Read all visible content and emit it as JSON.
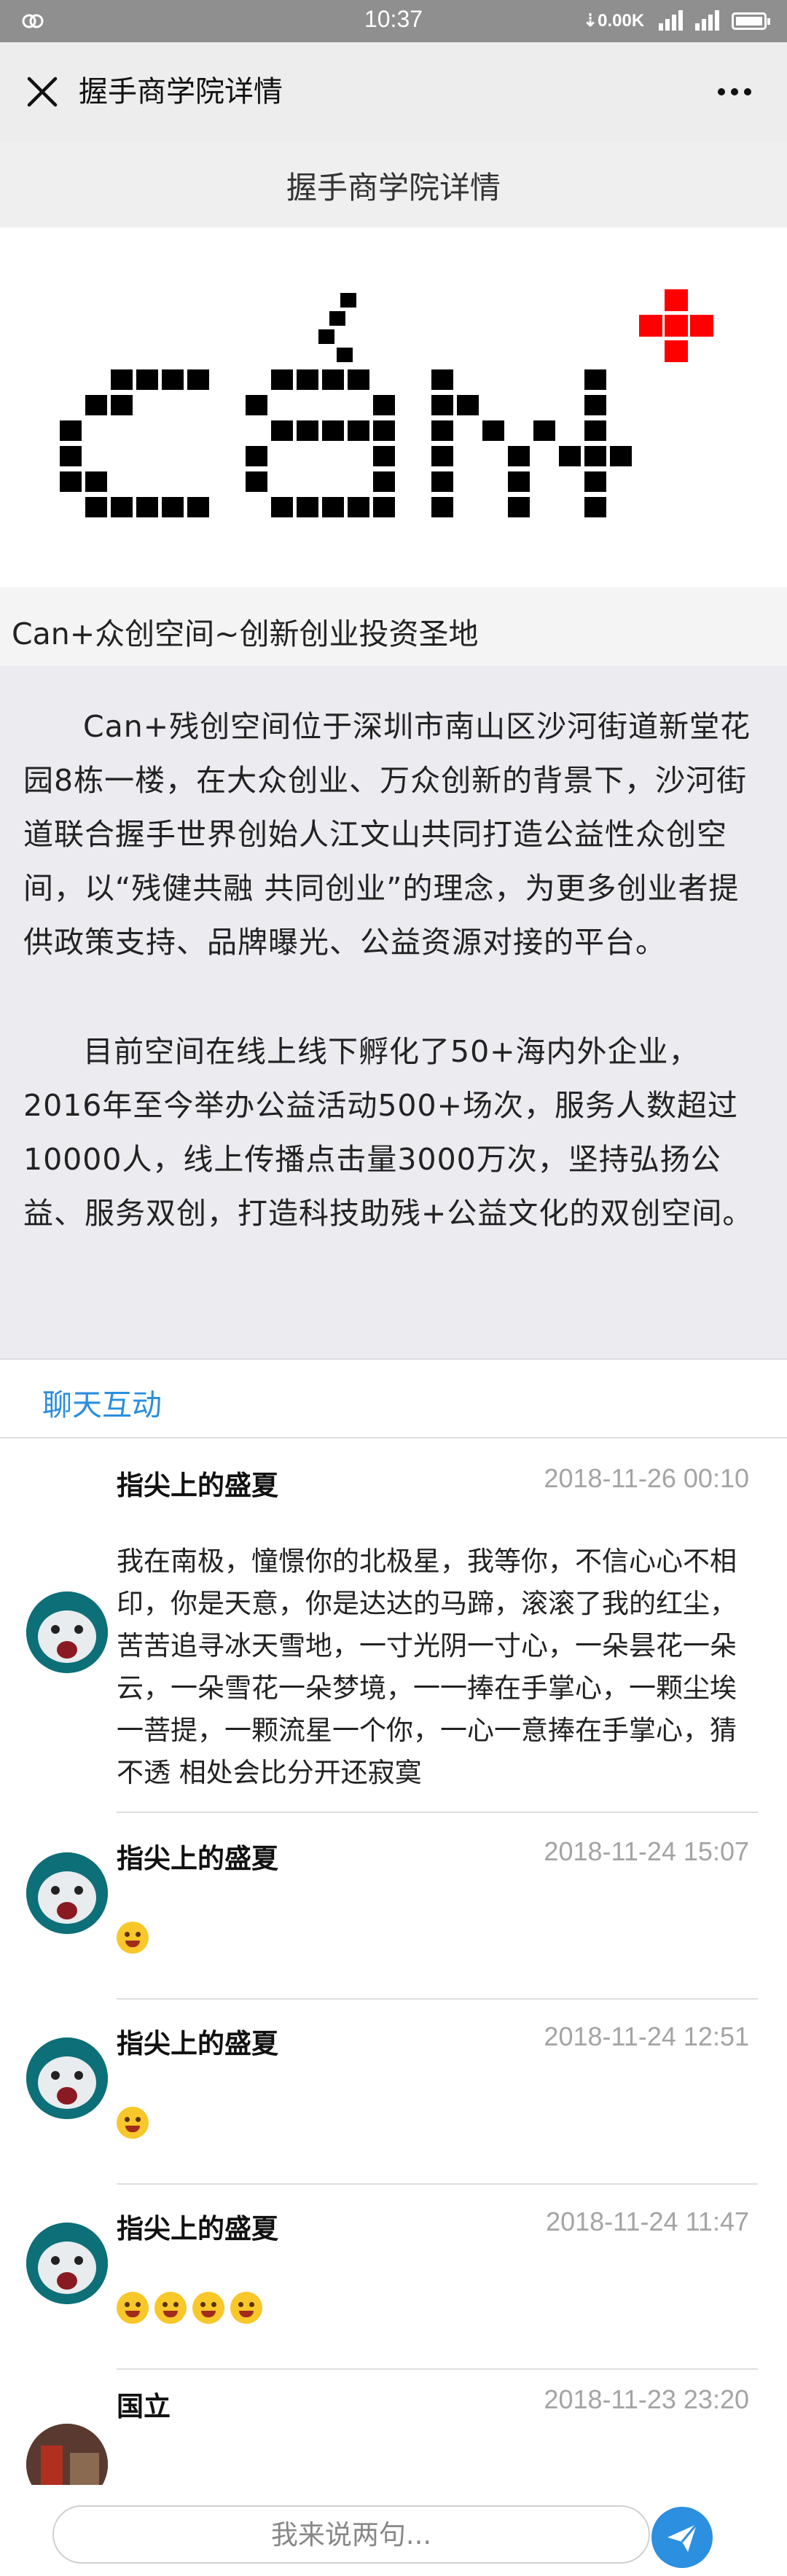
{
  "status_bar": {
    "time": "10:37",
    "net_speed": "⇣0.00K",
    "icons": [
      "circle-chain-icon",
      "signal-icon",
      "signal-icon",
      "battery-icon"
    ]
  },
  "title_bar": {
    "title": "握手商学院详情",
    "close_icon": "close-icon",
    "more_icon": "more-icon"
  },
  "page": {
    "header": "握手商学院详情",
    "banner_caption": "Can+众创空间~创新创业投资圣地",
    "banner_logo_text": "Can+",
    "description": [
      "Can+残创空间位于深圳市南山区沙河街道新堂花园8栋一楼，在大众创业、万众创新的背景下，沙河街道联合握手世界创始人江文山共同打造公益性众创空间，以“残健共融 共同创业”的理念，为更多创业者提供政策支持、品牌曝光、公益资源对接的平台。",
      "目前空间在线上线下孵化了50+海内外企业，2016年至今举办公益活动500+场次，服务人数超过10000人，线上传播点击量3000万次，坚持弘扬公益、服务双创，打造科技助残+公益文化的双创空间。"
    ]
  },
  "tabs": {
    "chat": "聊天互动"
  },
  "comments": [
    {
      "name": "指尖上的盛夏",
      "time": "2018-11-26 00:10",
      "text": "我在南极，憧憬你的北极星，我等你，不信心心不相印，你是天意，你是达达的马蹄，滚滚了我的红尘，苦苦追寻冰天雪地，一寸光阴一寸心，一朵昙花一朵云，一朵雪花一朵梦境，一一捧在手掌心，一颗尘埃一菩提，一颗流星一个你，一心一意捧在手掌心，猜不透 相处会比分开还寂寞"
    },
    {
      "name": "指尖上的盛夏",
      "time": "2018-11-24 15:07",
      "emojis": [
        "wink-tongue-emoji"
      ]
    },
    {
      "name": "指尖上的盛夏",
      "time": "2018-11-24 12:51",
      "emojis": [
        "crying-emoji"
      ]
    },
    {
      "name": "指尖上的盛夏",
      "time": "2018-11-24 11:47",
      "emojis": [
        "tongue-emoji",
        "squint-tongue-emoji",
        "tear-emoji",
        "pensive-emoji"
      ]
    },
    {
      "name": "国立",
      "time": "2018-11-23 23:20"
    }
  ],
  "input": {
    "placeholder": "我来说两句..."
  },
  "colors": {
    "accent": "#2c8fe0",
    "logo_red": "#ff0000",
    "status_bar": "#8f8f8f"
  }
}
